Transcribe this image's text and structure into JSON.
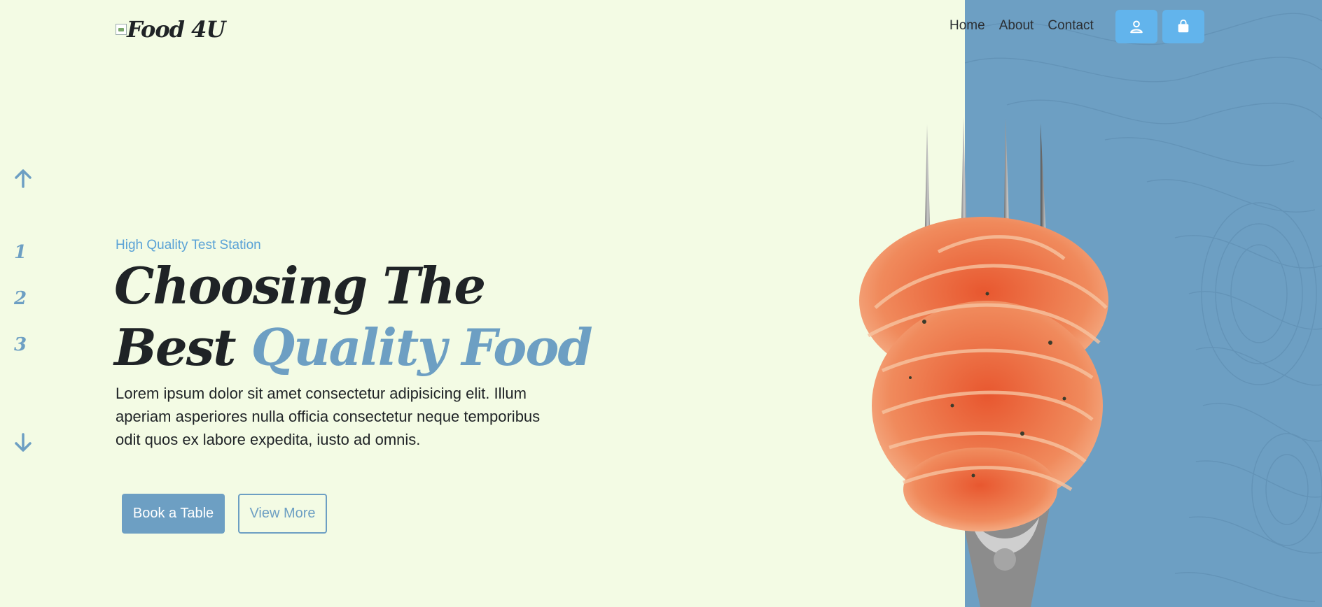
{
  "header": {
    "logo_text": "Food 4U",
    "nav": [
      "Home",
      "About",
      "Contact"
    ],
    "user_icon": "user-icon",
    "cart_icon": "shopping-bag-icon"
  },
  "slider": {
    "up_icon": "arrow-up-icon",
    "down_icon": "arrow-down-icon",
    "numbers": [
      "1",
      "2",
      "3"
    ]
  },
  "hero": {
    "eyebrow": "High Quality Test Station",
    "headline_line1": "Choosing The",
    "headline_line2_plain": "Best",
    "headline_line2_accent": "Quality Food",
    "description": "Lorem ipsum dolor sit amet consectetur adipisicing elit. Illum aperiam asperiores nulla officia consectetur neque temporibus odit quos ex labore expedita, iusto ad omnis.",
    "primary_button": "Book a Table",
    "secondary_button": "View More",
    "image_alt": "spaghetti-on-fork"
  },
  "colors": {
    "background": "#f3fbe4",
    "accent": "#6d9fc3",
    "header_button": "#62b4ec",
    "text": "#1f2326"
  }
}
